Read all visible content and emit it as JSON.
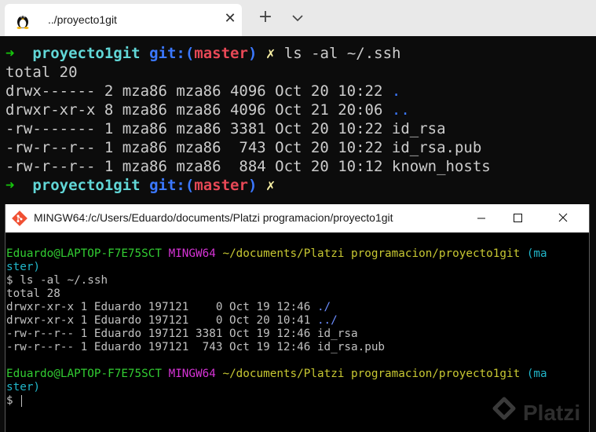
{
  "tab": {
    "title": "../proyecto1git",
    "icon": "linux-penguin-icon",
    "close_label": "✕"
  },
  "tabbar": {
    "new_tab_label": "+",
    "dropdown_icon": "chevron-down-icon"
  },
  "terminal": {
    "prompt1": {
      "arrow": "➜",
      "dir": "proyecto1git",
      "git_label": "git:",
      "open_paren": "(",
      "branch": "master",
      "close_paren": ")",
      "dirty_mark": "✗",
      "command": "ls -al ~/.ssh"
    },
    "total": "total 20",
    "rows": [
      {
        "meta": "drwx------ 2 mza86 mza86 4096 Oct 20 10:22 ",
        "name": ".",
        "is_dir": true
      },
      {
        "meta": "drwxr-xr-x 8 mza86 mza86 4096 Oct 21 20:06 ",
        "name": "..",
        "is_dir": true
      },
      {
        "meta": "-rw------- 1 mza86 mza86 3381 Oct 20 10:22 ",
        "name": "id_rsa",
        "is_dir": false
      },
      {
        "meta": "-rw-r--r-- 1 mza86 mza86  743 Oct 20 10:22 ",
        "name": "id_rsa.pub",
        "is_dir": false
      },
      {
        "meta": "-rw-r--r-- 1 mza86 mza86  884 Oct 20 10:12 ",
        "name": "known_hosts",
        "is_dir": false
      }
    ],
    "prompt2": {
      "arrow": "➜",
      "dir": "proyecto1git",
      "git_label": "git:",
      "open_paren": "(",
      "branch": "master",
      "close_paren": ")",
      "dirty_mark": "✗"
    }
  },
  "mingw": {
    "title": "MINGW64:/c/Users/Eduardo/documents/Platzi programacion/proyecto1git",
    "icon": "git-bash-icon",
    "buttons": {
      "minimize_icon": "minimize-icon",
      "maximize_icon": "maximize-icon",
      "close_icon": "close-icon"
    },
    "prompt1": {
      "user": "Eduardo@LAPTOP-F7E75SCT",
      "system": "MINGW64",
      "path": "~/documents/Platzi programacion/proyecto1git",
      "branch_a": "(ma",
      "branch_b": "ster)"
    },
    "command": "$ ls -al ~/.ssh",
    "total": "total 28",
    "rows": [
      {
        "meta": "drwxr-xr-x 1 Eduardo 197121    0 Oct 19 12:46 ",
        "name": "./",
        "is_dir": true
      },
      {
        "meta": "drwxr-xr-x 1 Eduardo 197121    0 Oct 20 10:41 ",
        "name": "../",
        "is_dir": true
      },
      {
        "meta": "-rw-r--r-- 1 Eduardo 197121 3381 Oct 19 12:46 ",
        "name": "id_rsa",
        "is_dir": false
      },
      {
        "meta": "-rw-r--r-- 1 Eduardo 197121  743 Oct 19 12:46 ",
        "name": "id_rsa.pub",
        "is_dir": false
      }
    ],
    "prompt2": {
      "user": "Eduardo@LAPTOP-F7E75SCT",
      "system": "MINGW64",
      "path": "~/documents/Platzi programacion/proyecto1git",
      "branch_a": "(ma",
      "branch_b": "ster)"
    },
    "dollar": "$"
  },
  "watermark": {
    "label": "Platzi",
    "icon": "platzi-logo-icon"
  },
  "colors": {
    "prompt_arrow": "#16c60c",
    "dir": "#61d6d6",
    "git_label": "#3b78ff",
    "branch": "#e74856",
    "mingw_user": "#32cd32",
    "mingw_system": "#d633d6",
    "mingw_path": "#c8c832",
    "mingw_branch": "#21b6c9"
  }
}
